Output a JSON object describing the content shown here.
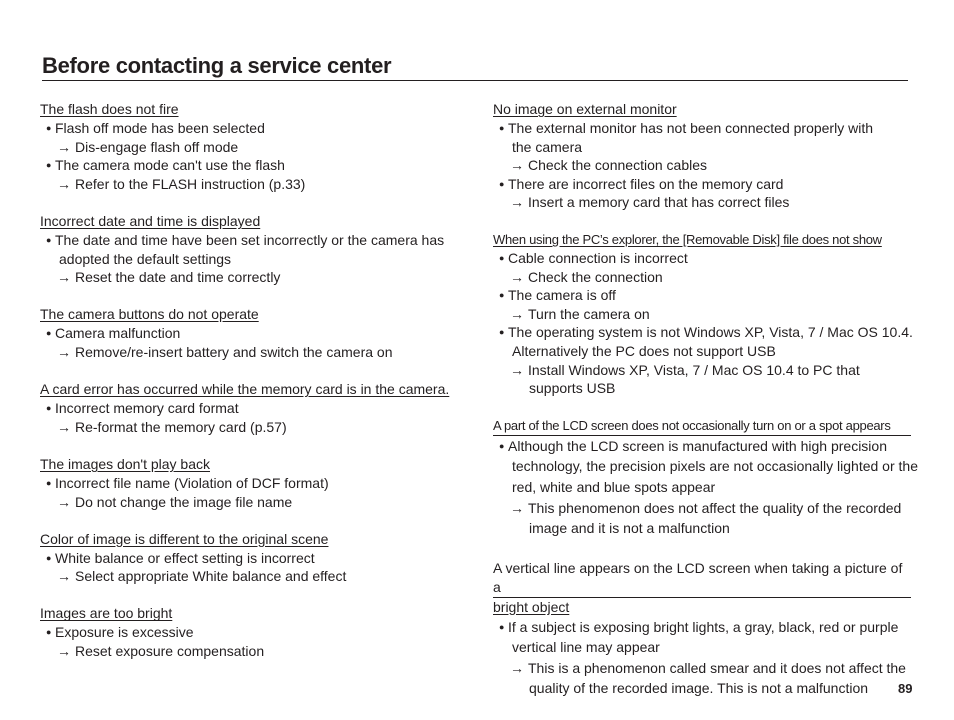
{
  "page": {
    "title": "Before contacting a service center",
    "page_number": "89"
  },
  "left_column": [
    {
      "title": "The flash does not fire",
      "lines": [
        {
          "kind": "bullet",
          "text": "Flash off mode has been selected"
        },
        {
          "kind": "arrow",
          "text": "Dis-engage flash off mode"
        },
        {
          "kind": "bullet",
          "text": "The camera mode can't use the flash"
        },
        {
          "kind": "arrow",
          "text": "Refer to the FLASH instruction (p.33)"
        }
      ]
    },
    {
      "title": "Incorrect date and time is displayed",
      "lines": [
        {
          "kind": "bullet",
          "text": "The date and time have been set incorrectly or the camera has"
        },
        {
          "kind": "cont",
          "text": "adopted the default settings"
        },
        {
          "kind": "arrow",
          "text": "Reset the date and time correctly"
        }
      ]
    },
    {
      "title": "The camera buttons do not operate",
      "lines": [
        {
          "kind": "bullet",
          "text": "Camera malfunction"
        },
        {
          "kind": "arrow",
          "text": "Remove/re-insert battery and switch the camera on"
        }
      ]
    },
    {
      "title": "A card error has occurred while the memory card is in the camera.",
      "lines": [
        {
          "kind": "bullet",
          "text": "Incorrect memory card format"
        },
        {
          "kind": "arrow",
          "text": "Re-format the memory card (p.57)"
        }
      ]
    },
    {
      "title": "The images don't play back",
      "lines": [
        {
          "kind": "bullet",
          "text": "Incorrect file name (Violation of DCF format)"
        },
        {
          "kind": "arrow",
          "text": "Do not change the image file name"
        }
      ]
    },
    {
      "title": "Color of image is different to the original scene",
      "lines": [
        {
          "kind": "bullet",
          "text": "White balance or effect setting is incorrect"
        },
        {
          "kind": "arrow",
          "text": "Select appropriate White balance and effect"
        }
      ]
    },
    {
      "title": "Images are too bright",
      "lines": [
        {
          "kind": "bullet",
          "text": "Exposure is excessive"
        },
        {
          "kind": "arrow",
          "text": "Reset exposure compensation"
        }
      ]
    }
  ],
  "right_column": [
    {
      "title": "No image on external monitor",
      "lines": [
        {
          "kind": "bullet",
          "text": "The external monitor has not been connected properly with"
        },
        {
          "kind": "cont",
          "text": "the camera"
        },
        {
          "kind": "arrow",
          "text": "Check the connection cables"
        },
        {
          "kind": "bullet",
          "text": "There are incorrect files on the memory card"
        },
        {
          "kind": "arrow",
          "text": "Insert a memory card that has correct files"
        }
      ]
    },
    {
      "title": "When using the PC’s explorer, the [Removable Disk] file does not show",
      "lines": [
        {
          "kind": "bullet",
          "text": "Cable connection is incorrect"
        },
        {
          "kind": "arrow",
          "text": "Check the connection"
        },
        {
          "kind": "bullet",
          "text": "The camera is off"
        },
        {
          "kind": "arrow",
          "text": "Turn the camera on"
        },
        {
          "kind": "bullet",
          "text": "The operating system is not Windows XP, Vista, 7 / Mac OS 10.4."
        },
        {
          "kind": "cont",
          "text": "Alternatively the PC does not support USB"
        },
        {
          "kind": "arrow",
          "text": "Install Windows XP, Vista, 7 / Mac OS 10.4 to PC that"
        },
        {
          "kind": "arrow-cont",
          "text": "supports USB"
        }
      ]
    },
    {
      "title": "A part of the LCD screen does not occasionally turn on or a spot appears",
      "lines": [
        {
          "kind": "bullet",
          "text": "Although the LCD screen is manufactured with high precision"
        },
        {
          "kind": "cont",
          "text": "technology, the precision pixels are not occasionally lighted or the"
        },
        {
          "kind": "cont",
          "text": "red, white and blue spots appear"
        },
        {
          "kind": "arrow",
          "text": "This phenomenon does not affect the quality of the recorded"
        },
        {
          "kind": "arrow-cont",
          "text": "image and it is not a malfunction"
        }
      ]
    },
    {
      "title": "A vertical line appears on the LCD screen when taking a picture of a",
      "title_cont": "bright object",
      "lines": [
        {
          "kind": "bullet",
          "text": "If a subject is exposing bright lights, a gray, black, red or purple"
        },
        {
          "kind": "cont",
          "text": "vertical line may appear"
        },
        {
          "kind": "arrow",
          "text": "This is a phenomenon called smear and it does not affect the"
        },
        {
          "kind": "arrow-cont",
          "text": "quality of the recorded image. This is not a malfunction"
        }
      ]
    }
  ],
  "glyphs": {
    "bullet": "●",
    "arrow": "→"
  }
}
